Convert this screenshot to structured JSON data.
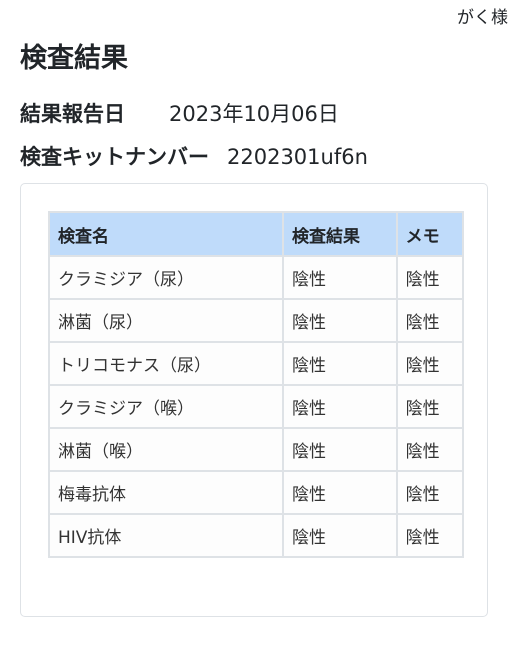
{
  "header": {
    "user_name": "がく様"
  },
  "page": {
    "title": "検査結果"
  },
  "info": {
    "report_date_label": "結果報告日",
    "report_date_value": "2023年10月06日",
    "kit_number_label": "検査キットナンバー",
    "kit_number_value": "2202301uf6n"
  },
  "colors": {
    "table_header_bg": "#bfdbfa",
    "border": "#dee2e6"
  },
  "table": {
    "headers": [
      "検査名",
      "検査結果",
      "メモ"
    ],
    "rows": [
      {
        "name": "クラミジア（尿）",
        "result": "陰性",
        "memo": "陰性"
      },
      {
        "name": "淋菌（尿）",
        "result": "陰性",
        "memo": "陰性"
      },
      {
        "name": "トリコモナス（尿）",
        "result": "陰性",
        "memo": "陰性"
      },
      {
        "name": "クラミジア（喉）",
        "result": "陰性",
        "memo": "陰性"
      },
      {
        "name": "淋菌（喉）",
        "result": "陰性",
        "memo": "陰性"
      },
      {
        "name": "梅毒抗体",
        "result": "陰性",
        "memo": "陰性"
      },
      {
        "name": "HIV抗体",
        "result": "陰性",
        "memo": "陰性"
      }
    ]
  }
}
